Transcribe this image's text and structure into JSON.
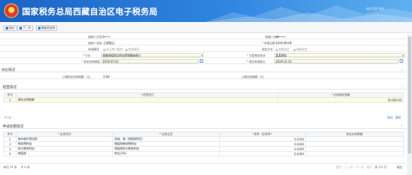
{
  "header": {
    "title": "国家税务总局西藏自治区电子税务局",
    "welcome": "欢迎 您好 退出",
    "colors": {
      "header_blue": "#1b63c4",
      "accent_red": "#e0352b"
    }
  },
  "toolbar": {
    "buttons": [
      {
        "label": "保存",
        "icon": "save-icon"
      },
      {
        "label": "下一步",
        "icon": "next-icon"
      },
      {
        "label": "数据项说明",
        "icon": "help-icon"
      }
    ]
  },
  "form": {
    "taxpayer_id_label": "纳税人识别号",
    "taxpayer_id_value": "••••",
    "name_label": "纳税人名称",
    "name_value": "••••••",
    "taxpayer_status_label": "纳税人状态",
    "taxpayer_status_value": "正常登记",
    "apply_date_label": "申请日期",
    "apply_date_value": "2019-09-06",
    "apply_type_label": "申请事项",
    "apply_type_options": [
      "非正常户解除",
      "其他事项"
    ],
    "method_label": "核定方式",
    "method_options": [
      "定额核定",
      "查账核定"
    ],
    "industry_label": "行业",
    "industry_value": "随着增值税及附加等税额纳税人",
    "authority_label": "主管税务机关",
    "authority_value": "某某税局",
    "start_label": "核定有效期起",
    "start_value": "2019-07-01",
    "end_label": "核定有效期止",
    "end_value": "2019-12-31"
  },
  "compare": {
    "title": "对比情况",
    "prev_label": "上期核定应纳税额（元）",
    "prev_value": "0.00",
    "current_label": "上期应纳税额（元）",
    "current_value": ""
  },
  "operations": {
    "title": "经营情况",
    "headers": [
      "序号",
      "经营项目",
      "应纳税经营额"
    ],
    "rows": [
      [
        "1",
        "服务业销售额",
        "50,000.00"
      ]
    ],
    "footer_note": "共1条"
  },
  "apply": {
    "title": "申请定额情况",
    "headers": [
      "序号",
      "征收项目",
      "征收品目",
      "税率（征收率）",
      "核定应纳税额"
    ],
    "rows": [
      [
        "1",
        "城市维护建设税",
        "县城、镇（增值税附征）",
        "0.0700",
        ""
      ],
      [
        "2",
        "教育费附加",
        "增值税教育费附加",
        "0.0300",
        ""
      ],
      [
        "3",
        "地方教育附加",
        "增值税地方教育附加",
        "0.0200",
        ""
      ],
      [
        "4",
        "增值税",
        "商业(3%)",
        "0.0300",
        ""
      ]
    ]
  },
  "pager": {
    "per_page": "每页 10 条",
    "total": "共 4 条",
    "first": "首页",
    "prev": "上一页",
    "next": "下一页",
    "last": "尾页",
    "page_info": "第 1/1 页",
    "go": "确定"
  }
}
